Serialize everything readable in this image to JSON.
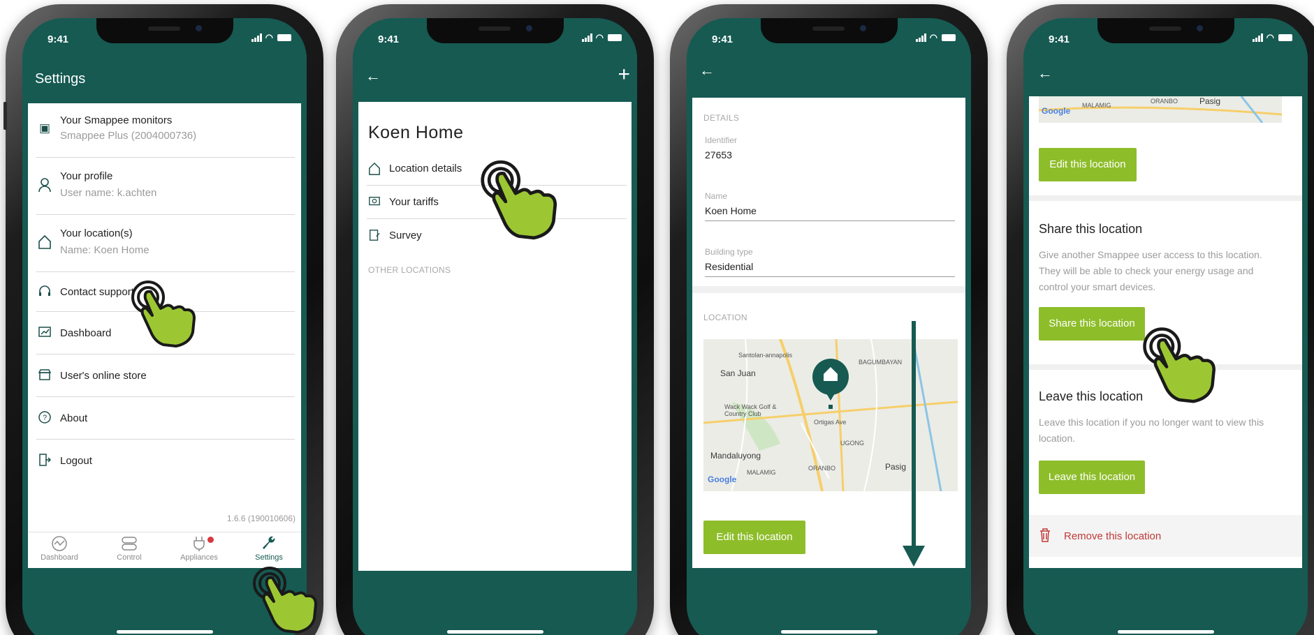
{
  "status": {
    "time": "9:41"
  },
  "phone1": {
    "title": "Settings",
    "items": [
      {
        "label": "Your Smappee monitors",
        "sub": "Smappee Plus (2004000736)",
        "icon": "monitor-icon"
      },
      {
        "label": "Your profile",
        "sub": "User name: k.achten",
        "icon": "user-icon"
      },
      {
        "label": "Your location(s)",
        "sub": "Name: Koen Home",
        "icon": "home-icon"
      },
      {
        "label": "Contact support",
        "icon": "headset-icon"
      },
      {
        "label": "Dashboard",
        "icon": "chart-icon"
      },
      {
        "label": "User's online store",
        "icon": "store-icon"
      },
      {
        "label": "About",
        "icon": "question-icon"
      },
      {
        "label": "Logout",
        "icon": "logout-icon"
      }
    ],
    "version": "1.6.6 (190010606)",
    "tabs": [
      {
        "label": "Dashboard",
        "icon": "dashboard-icon"
      },
      {
        "label": "Control",
        "icon": "control-icon"
      },
      {
        "label": "Appliances",
        "icon": "plug-icon"
      },
      {
        "label": "Settings",
        "icon": "wrench-icon"
      }
    ]
  },
  "phone2": {
    "heading": "Koen Home",
    "rows": [
      {
        "label": "Location details",
        "icon": "home-icon"
      },
      {
        "label": "Your tariffs",
        "icon": "tariff-icon"
      },
      {
        "label": "Survey",
        "icon": "survey-icon"
      }
    ],
    "other_locations": "OTHER LOCATIONS"
  },
  "phone3": {
    "details_caption": "DETAILS",
    "identifier_label": "Identifier",
    "identifier_value": "27653",
    "name_label": "Name",
    "name_value": "Koen Home",
    "building_label": "Building type",
    "building_value": "Residential",
    "location_caption": "LOCATION",
    "map_labels": {
      "san_juan": "San Juan",
      "mandaluyong": "Mandaluyong",
      "pasig": "Pasig",
      "bagumbayan": "BAGUMBAYAN",
      "ugong": "UGONG",
      "santolan": "Santolan-annapolis",
      "wackwack": "Wack Wack Golf & Country Club",
      "malamig": "MALAMIG",
      "oranbo": "ORANBO",
      "ortigas": "Ortigas Ave",
      "google": "Google"
    },
    "edit_button": "Edit this location"
  },
  "phone4": {
    "map_labels": {
      "malamig": "MALAMIG",
      "oranbo": "ORANBO",
      "pasig": "Pasig",
      "google": "Google"
    },
    "edit_button": "Edit this location",
    "share_heading": "Share this location",
    "share_text": "Give another Smappee user access to this location. They will be able to check your energy usage and control your smart devices.",
    "share_button": "Share this location",
    "leave_heading": "Leave this location",
    "leave_text": "Leave this location if you no longer want to view this location.",
    "leave_button": "Leave this location",
    "remove_label": "Remove this location"
  },
  "colors": {
    "brand": "#165a52",
    "accent": "#8ebd2a",
    "danger": "#c03a37"
  }
}
